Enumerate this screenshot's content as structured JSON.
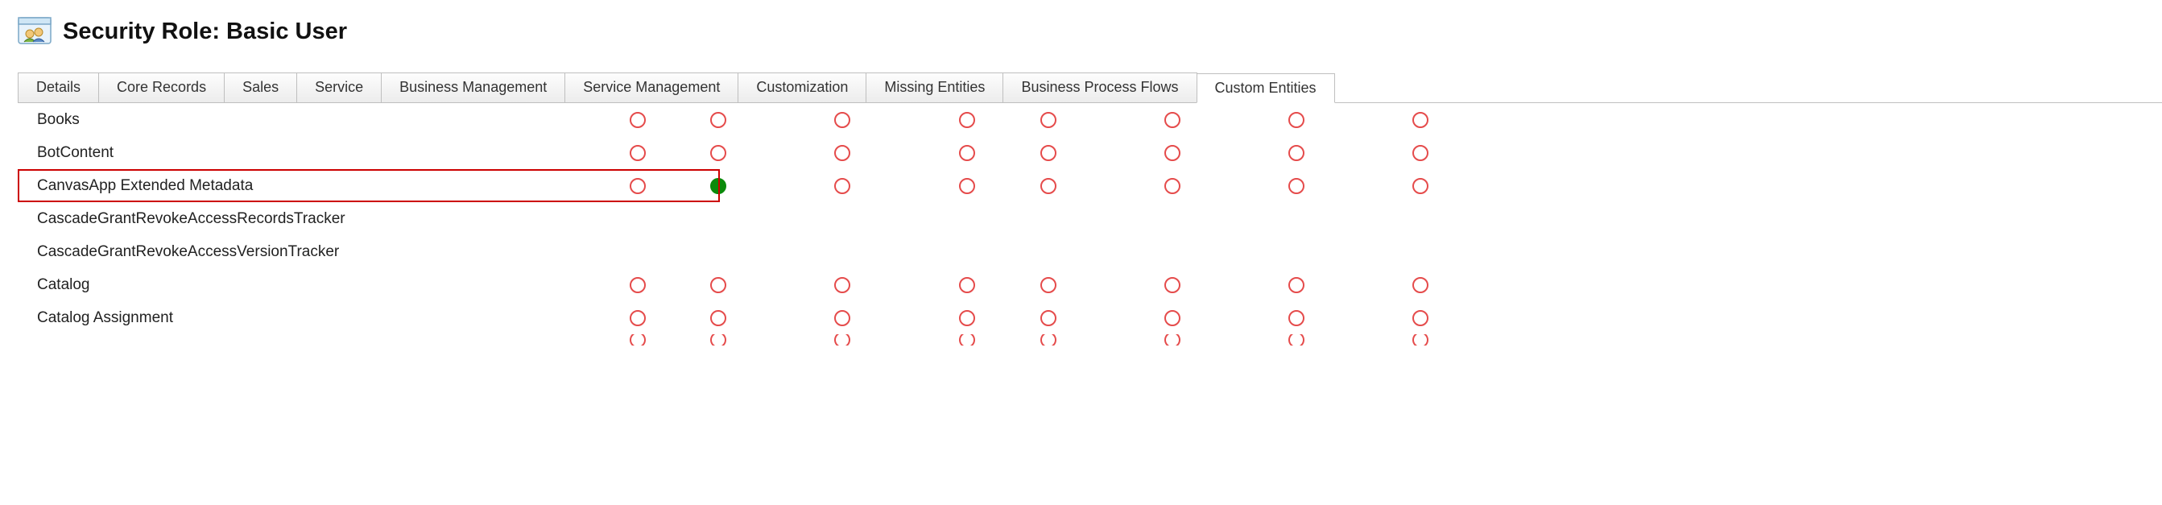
{
  "header": {
    "title": "Security Role: Basic User"
  },
  "tabs": [
    {
      "label": "Details",
      "active": false
    },
    {
      "label": "Core Records",
      "active": false
    },
    {
      "label": "Sales",
      "active": false
    },
    {
      "label": "Service",
      "active": false
    },
    {
      "label": "Business Management",
      "active": false
    },
    {
      "label": "Service Management",
      "active": false
    },
    {
      "label": "Customization",
      "active": false
    },
    {
      "label": "Missing Entities",
      "active": false
    },
    {
      "label": "Business Process Flows",
      "active": false
    },
    {
      "label": "Custom Entities",
      "active": true
    }
  ],
  "entities": [
    {
      "name": "Books",
      "highlighted": false,
      "privs": [
        "none",
        "none",
        "none",
        "none",
        "none",
        "none",
        "none",
        "none"
      ]
    },
    {
      "name": "BotContent",
      "highlighted": false,
      "privs": [
        "none",
        "none",
        "none",
        "none",
        "none",
        "none",
        "none",
        "none"
      ]
    },
    {
      "name": "CanvasApp Extended Metadata",
      "highlighted": true,
      "privs": [
        "none",
        "org",
        "none",
        "none",
        "none",
        "none",
        "none",
        "none"
      ]
    },
    {
      "name": "CascadeGrantRevokeAccessRecordsTracker",
      "highlighted": false,
      "privs": []
    },
    {
      "name": "CascadeGrantRevokeAccessVersionTracker",
      "highlighted": false,
      "privs": []
    },
    {
      "name": "Catalog",
      "highlighted": false,
      "privs": [
        "none",
        "none",
        "none",
        "none",
        "none",
        "none",
        "none",
        "none"
      ]
    },
    {
      "name": "Catalog Assignment",
      "highlighted": false,
      "privs": [
        "none",
        "none",
        "none",
        "none",
        "none",
        "none",
        "none",
        "none"
      ]
    }
  ],
  "partial_row_privs": [
    "none",
    "none",
    "none",
    "none",
    "none",
    "none",
    "none",
    "none"
  ]
}
